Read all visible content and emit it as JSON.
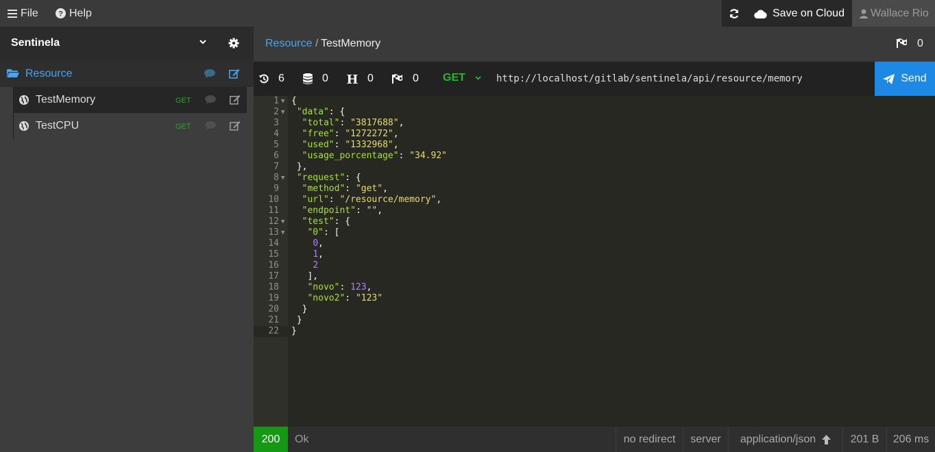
{
  "topbar": {
    "file_label": "File",
    "help_label": "Help",
    "save_cloud_label": "Save on Cloud",
    "user_label": "Wallace Rio"
  },
  "sidebar": {
    "project_title": "Sentinela",
    "folder_label": "Resource",
    "items": [
      {
        "label": "TestMemory",
        "method": "GET"
      },
      {
        "label": "TestCPU",
        "method": "GET"
      }
    ]
  },
  "breadcrumb": {
    "parent": "Resource",
    "separator": "/",
    "current": "TestMemory",
    "flag_count": "0"
  },
  "request": {
    "history_count": "6",
    "db_count": "0",
    "header_count": "0",
    "flag_count": "0",
    "method": "GET",
    "url": "http://localhost/gitlab/sentinela/api/resource/memory",
    "send_label": "Send"
  },
  "status": {
    "code": "200",
    "text": "Ok",
    "redirect": "no redirect",
    "source": "server",
    "content_type": "application/json",
    "size": "201 B",
    "time": "206 ms"
  },
  "colors": {
    "accent_blue": "#1e88e5",
    "link_blue": "#4aa3f0",
    "status_green": "#159915",
    "method_green": "#22bb22"
  }
}
